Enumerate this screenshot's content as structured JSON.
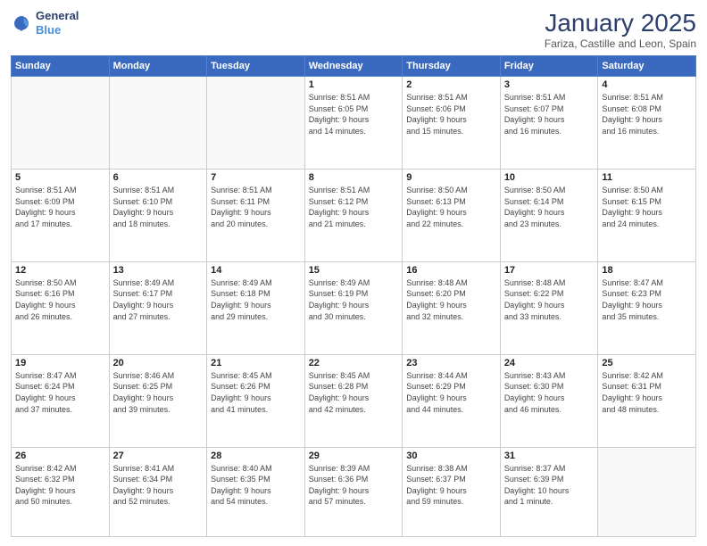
{
  "logo": {
    "line1": "General",
    "line2": "Blue"
  },
  "header": {
    "month": "January 2025",
    "location": "Fariza, Castille and Leon, Spain"
  },
  "days_of_week": [
    "Sunday",
    "Monday",
    "Tuesday",
    "Wednesday",
    "Thursday",
    "Friday",
    "Saturday"
  ],
  "weeks": [
    [
      {
        "day": "",
        "info": ""
      },
      {
        "day": "",
        "info": ""
      },
      {
        "day": "",
        "info": ""
      },
      {
        "day": "1",
        "info": "Sunrise: 8:51 AM\nSunset: 6:05 PM\nDaylight: 9 hours\nand 14 minutes."
      },
      {
        "day": "2",
        "info": "Sunrise: 8:51 AM\nSunset: 6:06 PM\nDaylight: 9 hours\nand 15 minutes."
      },
      {
        "day": "3",
        "info": "Sunrise: 8:51 AM\nSunset: 6:07 PM\nDaylight: 9 hours\nand 16 minutes."
      },
      {
        "day": "4",
        "info": "Sunrise: 8:51 AM\nSunset: 6:08 PM\nDaylight: 9 hours\nand 16 minutes."
      }
    ],
    [
      {
        "day": "5",
        "info": "Sunrise: 8:51 AM\nSunset: 6:09 PM\nDaylight: 9 hours\nand 17 minutes."
      },
      {
        "day": "6",
        "info": "Sunrise: 8:51 AM\nSunset: 6:10 PM\nDaylight: 9 hours\nand 18 minutes."
      },
      {
        "day": "7",
        "info": "Sunrise: 8:51 AM\nSunset: 6:11 PM\nDaylight: 9 hours\nand 20 minutes."
      },
      {
        "day": "8",
        "info": "Sunrise: 8:51 AM\nSunset: 6:12 PM\nDaylight: 9 hours\nand 21 minutes."
      },
      {
        "day": "9",
        "info": "Sunrise: 8:50 AM\nSunset: 6:13 PM\nDaylight: 9 hours\nand 22 minutes."
      },
      {
        "day": "10",
        "info": "Sunrise: 8:50 AM\nSunset: 6:14 PM\nDaylight: 9 hours\nand 23 minutes."
      },
      {
        "day": "11",
        "info": "Sunrise: 8:50 AM\nSunset: 6:15 PM\nDaylight: 9 hours\nand 24 minutes."
      }
    ],
    [
      {
        "day": "12",
        "info": "Sunrise: 8:50 AM\nSunset: 6:16 PM\nDaylight: 9 hours\nand 26 minutes."
      },
      {
        "day": "13",
        "info": "Sunrise: 8:49 AM\nSunset: 6:17 PM\nDaylight: 9 hours\nand 27 minutes."
      },
      {
        "day": "14",
        "info": "Sunrise: 8:49 AM\nSunset: 6:18 PM\nDaylight: 9 hours\nand 29 minutes."
      },
      {
        "day": "15",
        "info": "Sunrise: 8:49 AM\nSunset: 6:19 PM\nDaylight: 9 hours\nand 30 minutes."
      },
      {
        "day": "16",
        "info": "Sunrise: 8:48 AM\nSunset: 6:20 PM\nDaylight: 9 hours\nand 32 minutes."
      },
      {
        "day": "17",
        "info": "Sunrise: 8:48 AM\nSunset: 6:22 PM\nDaylight: 9 hours\nand 33 minutes."
      },
      {
        "day": "18",
        "info": "Sunrise: 8:47 AM\nSunset: 6:23 PM\nDaylight: 9 hours\nand 35 minutes."
      }
    ],
    [
      {
        "day": "19",
        "info": "Sunrise: 8:47 AM\nSunset: 6:24 PM\nDaylight: 9 hours\nand 37 minutes."
      },
      {
        "day": "20",
        "info": "Sunrise: 8:46 AM\nSunset: 6:25 PM\nDaylight: 9 hours\nand 39 minutes."
      },
      {
        "day": "21",
        "info": "Sunrise: 8:45 AM\nSunset: 6:26 PM\nDaylight: 9 hours\nand 41 minutes."
      },
      {
        "day": "22",
        "info": "Sunrise: 8:45 AM\nSunset: 6:28 PM\nDaylight: 9 hours\nand 42 minutes."
      },
      {
        "day": "23",
        "info": "Sunrise: 8:44 AM\nSunset: 6:29 PM\nDaylight: 9 hours\nand 44 minutes."
      },
      {
        "day": "24",
        "info": "Sunrise: 8:43 AM\nSunset: 6:30 PM\nDaylight: 9 hours\nand 46 minutes."
      },
      {
        "day": "25",
        "info": "Sunrise: 8:42 AM\nSunset: 6:31 PM\nDaylight: 9 hours\nand 48 minutes."
      }
    ],
    [
      {
        "day": "26",
        "info": "Sunrise: 8:42 AM\nSunset: 6:32 PM\nDaylight: 9 hours\nand 50 minutes."
      },
      {
        "day": "27",
        "info": "Sunrise: 8:41 AM\nSunset: 6:34 PM\nDaylight: 9 hours\nand 52 minutes."
      },
      {
        "day": "28",
        "info": "Sunrise: 8:40 AM\nSunset: 6:35 PM\nDaylight: 9 hours\nand 54 minutes."
      },
      {
        "day": "29",
        "info": "Sunrise: 8:39 AM\nSunset: 6:36 PM\nDaylight: 9 hours\nand 57 minutes."
      },
      {
        "day": "30",
        "info": "Sunrise: 8:38 AM\nSunset: 6:37 PM\nDaylight: 9 hours\nand 59 minutes."
      },
      {
        "day": "31",
        "info": "Sunrise: 8:37 AM\nSunset: 6:39 PM\nDaylight: 10 hours\nand 1 minute."
      },
      {
        "day": "",
        "info": ""
      }
    ]
  ]
}
